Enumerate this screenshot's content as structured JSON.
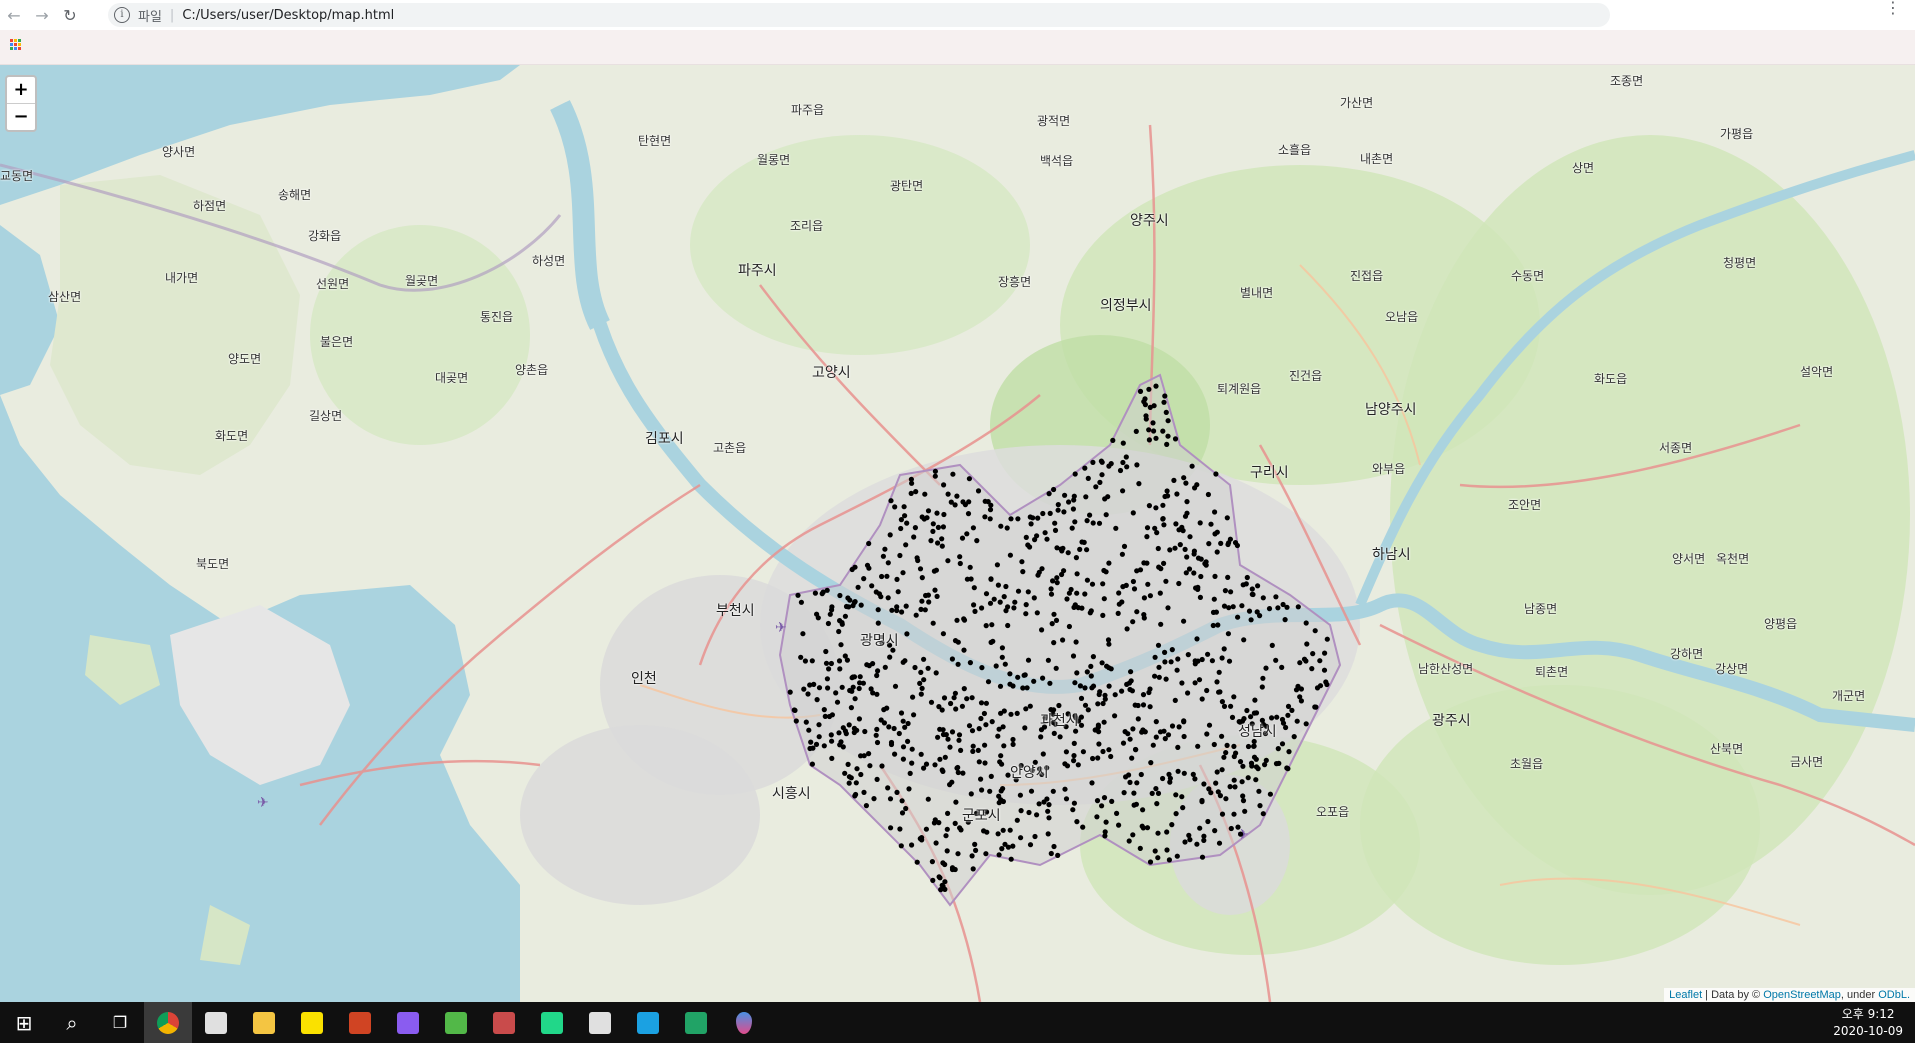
{
  "browser": {
    "url_scheme": "파일",
    "url": "C:/Users/user/Desktop/map.html",
    "back_icon": "arrow-left-icon",
    "forward_icon": "arrow-right-icon",
    "reload_icon": "reload-icon",
    "menu_icon": "kebab-menu-icon"
  },
  "map": {
    "zoom_in": "+",
    "zoom_out": "−",
    "attribution": {
      "leaflet": "Leaflet",
      "sep": " | Data by © ",
      "osm": "OpenStreetMap",
      "under": ", under ",
      "odbl": "ODbL."
    },
    "places": [
      {
        "name": "파주시",
        "cls": "city"
      },
      {
        "name": "양주시",
        "cls": "city"
      },
      {
        "name": "의정부시",
        "cls": "city"
      },
      {
        "name": "고양시",
        "cls": "city"
      },
      {
        "name": "김포시",
        "cls": "city"
      },
      {
        "name": "구리시",
        "cls": "city"
      },
      {
        "name": "남양주시",
        "cls": "city"
      },
      {
        "name": "하남시",
        "cls": "city"
      },
      {
        "name": "부천시",
        "cls": "city"
      },
      {
        "name": "광명시",
        "cls": "city"
      },
      {
        "name": "인천",
        "cls": "city"
      },
      {
        "name": "과천시",
        "cls": "city"
      },
      {
        "name": "성남시",
        "cls": "city"
      },
      {
        "name": "광주시",
        "cls": "city"
      },
      {
        "name": "안양시",
        "cls": "city"
      },
      {
        "name": "시흥시",
        "cls": "city"
      },
      {
        "name": "군포시",
        "cls": "city"
      },
      {
        "name": "양사면",
        "cls": ""
      },
      {
        "name": "교동면",
        "cls": ""
      },
      {
        "name": "송해면",
        "cls": ""
      },
      {
        "name": "하점면",
        "cls": ""
      },
      {
        "name": "강화읍",
        "cls": ""
      },
      {
        "name": "내가면",
        "cls": ""
      },
      {
        "name": "선원면",
        "cls": ""
      },
      {
        "name": "삼산면",
        "cls": ""
      },
      {
        "name": "불은면",
        "cls": ""
      },
      {
        "name": "양도면",
        "cls": ""
      },
      {
        "name": "길상면",
        "cls": ""
      },
      {
        "name": "화도면",
        "cls": ""
      },
      {
        "name": "북도면",
        "cls": ""
      },
      {
        "name": "하성면",
        "cls": ""
      },
      {
        "name": "월곶면",
        "cls": ""
      },
      {
        "name": "통진읍",
        "cls": ""
      },
      {
        "name": "대곶면",
        "cls": ""
      },
      {
        "name": "양촌읍",
        "cls": ""
      },
      {
        "name": "고촌읍",
        "cls": ""
      },
      {
        "name": "탄현면",
        "cls": ""
      },
      {
        "name": "파주읍",
        "cls": ""
      },
      {
        "name": "월롱면",
        "cls": ""
      },
      {
        "name": "광탄면",
        "cls": ""
      },
      {
        "name": "조리읍",
        "cls": ""
      },
      {
        "name": "광적면",
        "cls": ""
      },
      {
        "name": "백석읍",
        "cls": ""
      },
      {
        "name": "장흥면",
        "cls": ""
      },
      {
        "name": "가산면",
        "cls": ""
      },
      {
        "name": "소흘읍",
        "cls": ""
      },
      {
        "name": "내촌면",
        "cls": ""
      },
      {
        "name": "별내면",
        "cls": ""
      },
      {
        "name": "진접읍",
        "cls": ""
      },
      {
        "name": "오남읍",
        "cls": ""
      },
      {
        "name": "퇴계원읍",
        "cls": ""
      },
      {
        "name": "진건읍",
        "cls": ""
      },
      {
        "name": "와부읍",
        "cls": ""
      },
      {
        "name": "조안면",
        "cls": ""
      },
      {
        "name": "수동면",
        "cls": ""
      },
      {
        "name": "화도읍",
        "cls": ""
      },
      {
        "name": "조종면",
        "cls": ""
      },
      {
        "name": "상면",
        "cls": ""
      },
      {
        "name": "가평읍",
        "cls": ""
      },
      {
        "name": "청평면",
        "cls": ""
      },
      {
        "name": "설악면",
        "cls": ""
      },
      {
        "name": "서종면",
        "cls": ""
      },
      {
        "name": "양서면",
        "cls": ""
      },
      {
        "name": "옥천면",
        "cls": ""
      },
      {
        "name": "남종면",
        "cls": ""
      },
      {
        "name": "강하면",
        "cls": ""
      },
      {
        "name": "퇴촌면",
        "cls": ""
      },
      {
        "name": "남한산성면",
        "cls": ""
      },
      {
        "name": "강상면",
        "cls": ""
      },
      {
        "name": "양평읍",
        "cls": ""
      },
      {
        "name": "개군면",
        "cls": ""
      },
      {
        "name": "산북면",
        "cls": ""
      },
      {
        "name": "금사면",
        "cls": ""
      },
      {
        "name": "초월읍",
        "cls": ""
      },
      {
        "name": "오포읍",
        "cls": ""
      }
    ]
  },
  "taskbar": {
    "time": "오후 9:12",
    "date": "2020-10-09",
    "apps": [
      {
        "icon": "windows-start-icon",
        "color": "#ffffff"
      },
      {
        "icon": "search-icon",
        "color": "#ffffff"
      },
      {
        "icon": "task-view-icon",
        "color": "#ffffff"
      },
      {
        "icon": "chrome-icon",
        "color": "#dd4b39"
      },
      {
        "icon": "app-icon",
        "color": "#e0e0e0"
      },
      {
        "icon": "folder-icon",
        "color": "#f4c542"
      },
      {
        "icon": "kakaotalk-icon",
        "color": "#fae100"
      },
      {
        "icon": "powerpoint-icon",
        "color": "#d04423"
      },
      {
        "icon": "app-icon",
        "color": "#8a5cf0"
      },
      {
        "icon": "qlik-icon",
        "color": "#52b848"
      },
      {
        "icon": "app-icon",
        "color": "#c94b4b"
      },
      {
        "icon": "pycharm-icon",
        "color": "#21d789"
      },
      {
        "icon": "app-icon",
        "color": "#e0e0e0"
      },
      {
        "icon": "app-icon",
        "color": "#1ba1e2"
      },
      {
        "icon": "excel-icon",
        "color": "#21a366"
      },
      {
        "icon": "maps-icon",
        "color": "#e04c8c"
      }
    ]
  }
}
